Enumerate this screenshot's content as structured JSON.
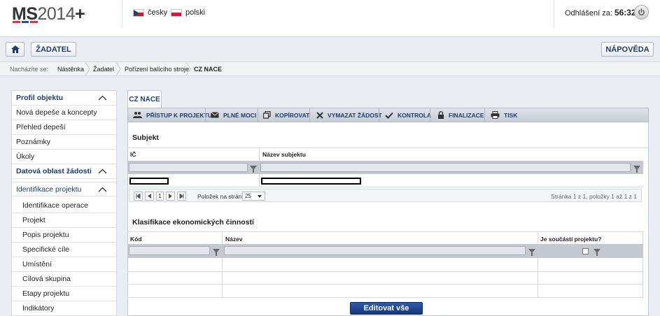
{
  "header": {
    "logo_main": "MS",
    "logo_year": "2014",
    "logo_plus": "+",
    "logo_colors": [
      "#e2313a",
      "#2c4f9d",
      "#e2313a"
    ],
    "languages": [
      {
        "label": "česky",
        "flag": "flag-cz-icon"
      },
      {
        "label": "polski",
        "flag": "flag-pl-icon"
      }
    ],
    "logout_label": "Odhlášení za:",
    "logout_timer": "56:32"
  },
  "toolbar": {
    "home_icon": "home-icon",
    "applicant_label": "ŽADATEL",
    "help_label": "NÁPOVĚDA"
  },
  "breadcrumb": {
    "prefix": "Nacházíte se:",
    "items": [
      "Nástěnka",
      "Žadatel",
      "Pořízení balícího stroje",
      "CZ NACE"
    ]
  },
  "sidebar": {
    "items": [
      {
        "label": "Profil objektu",
        "type": "head"
      },
      {
        "label": "Nová depeše a koncepty",
        "type": "item"
      },
      {
        "label": "Přehled depeší",
        "type": "item"
      },
      {
        "label": "Poznámky",
        "type": "item"
      },
      {
        "label": "Úkoly",
        "type": "item"
      },
      {
        "label": "Datová oblast žádosti",
        "type": "head"
      },
      {
        "label": "Identifikace projektu",
        "type": "head"
      },
      {
        "label": "Identifikace operace",
        "type": "sub"
      },
      {
        "label": "Projekt",
        "type": "sub"
      },
      {
        "label": "Popis projektu",
        "type": "sub"
      },
      {
        "label": "Specifické cíle",
        "type": "sub"
      },
      {
        "label": "Umístění",
        "type": "sub"
      },
      {
        "label": "Cílová skupina",
        "type": "sub"
      },
      {
        "label": "Etapy projektu",
        "type": "sub"
      },
      {
        "label": "Indikátory",
        "type": "sub"
      }
    ]
  },
  "main": {
    "tab_label": "CZ NACE",
    "actions": [
      {
        "label": "PŘÍSTUP K PROJEKTU",
        "icon": "users-icon"
      },
      {
        "label": "PLNÉ MOCI",
        "icon": "envelope-icon"
      },
      {
        "label": "KOPÍROVAT",
        "icon": "copy-icon"
      },
      {
        "label": "VYMAZAT ŽÁDOST",
        "icon": "delete-icon"
      },
      {
        "label": "KONTROLA",
        "icon": "check-icon"
      },
      {
        "label": "FINALIZACE",
        "icon": "lock-icon"
      },
      {
        "label": "TISK",
        "icon": "print-icon"
      }
    ],
    "subject": {
      "title": "Subjekt",
      "col_ic": "IČ",
      "col_name": "Název subjektu",
      "pager": {
        "current_page": "1",
        "page_size_label": "Položek na stránku",
        "page_size": "25",
        "info": "Stránka 1 z 1, položky 1 až 1 z 1"
      }
    },
    "classification": {
      "title": "Klasifikace ekonomických činností",
      "col_code": "Kód",
      "col_name": "Název",
      "col_part": "Je součástí projektu?"
    },
    "edit_all_label": "Editovat vše"
  }
}
